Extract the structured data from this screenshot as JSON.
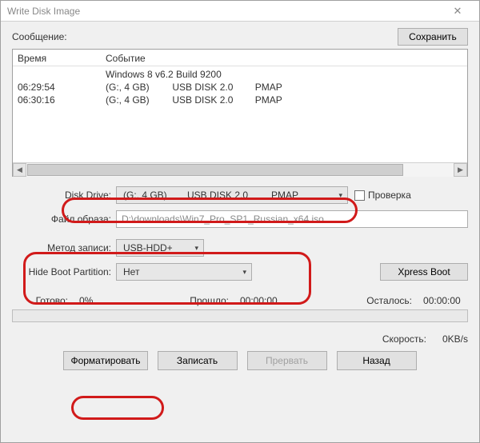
{
  "window": {
    "title": "Write Disk Image"
  },
  "message": {
    "label": "Сообщение:",
    "save_btn": "Сохранить",
    "headers": {
      "time": "Время",
      "event": "Событие"
    },
    "rows": [
      {
        "time": "",
        "event_full": "Windows 8 v6.2 Build 9200"
      },
      {
        "time": "06:29:54",
        "ev1": "(G:, 4 GB)",
        "ev2": "USB DISK 2.0",
        "ev3": "PMAP"
      },
      {
        "time": "06:30:16",
        "ev1": "(G:, 4 GB)",
        "ev2": "USB DISK 2.0",
        "ev3": "PMAP"
      }
    ]
  },
  "form": {
    "drive_label": "Disk Drive:",
    "drive": {
      "p1": "(G:, 4 GB)",
      "p2": "USB DISK 2.0",
      "p3": "PMAP"
    },
    "verify_label": "Проверка",
    "image_label": "Файл образа:",
    "image_path": "D:\\downloads\\Win7_Pro_SP1_Russian_x64.iso",
    "method_label": "Метод записи:",
    "method_value": "USB-HDD+",
    "hide_label": "Hide Boot Partition:",
    "hide_value": "Нет",
    "xpress_btn": "Xpress Boot"
  },
  "progress": {
    "ready_label": "Готово:",
    "ready_value": "0%",
    "elapsed_label": "Прошло:",
    "elapsed_value": "00:00:00",
    "remain_label": "Осталось:",
    "remain_value": "00:00:00",
    "speed_label": "Скорость:",
    "speed_value": "0KB/s"
  },
  "buttons": {
    "format": "Форматировать",
    "write": "Записать",
    "abort": "Прервать",
    "back": "Назад"
  }
}
